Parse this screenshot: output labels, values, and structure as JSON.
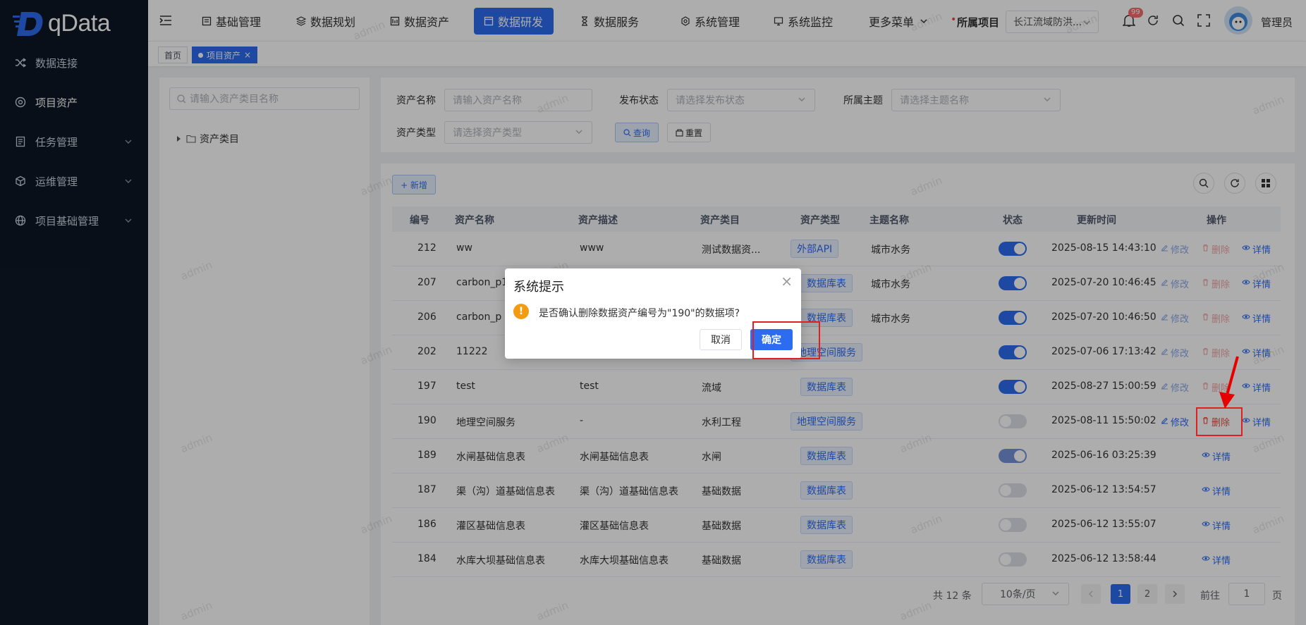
{
  "app": {
    "logo_text": "qData",
    "logo_letter": "D"
  },
  "sidebar": {
    "items": [
      {
        "label": "数据连接",
        "icon": "shuffle-icon",
        "has_children": false
      },
      {
        "label": "项目资产",
        "icon": "target-icon",
        "has_children": false
      },
      {
        "label": "任务管理",
        "icon": "document-list-icon",
        "has_children": true
      },
      {
        "label": "运维管理",
        "icon": "cube-icon",
        "has_children": true
      },
      {
        "label": "项目基础管理",
        "icon": "globe-icon",
        "has_children": true
      }
    ]
  },
  "topbar": {
    "menus": [
      {
        "label": "基础管理",
        "icon": "list-box-icon"
      },
      {
        "label": "数据规划",
        "icon": "layers-icon"
      },
      {
        "label": "数据资产",
        "icon": "database-doc-icon"
      },
      {
        "label": "数据研发",
        "icon": "window-icon",
        "active": true
      },
      {
        "label": "数据服务",
        "icon": "hourglass-icon"
      },
      {
        "label": "系统管理",
        "icon": "gear-icon"
      },
      {
        "label": "系统监控",
        "icon": "monitor-icon"
      },
      {
        "label": "更多菜单",
        "icon": "chevron-down-icon"
      }
    ],
    "project_label": "所属项目",
    "project_value": "长江流域防洪...",
    "notification_badge": "99",
    "user_name": "管理员"
  },
  "tags": {
    "home": "首页",
    "current": "项目资产"
  },
  "tree": {
    "search_placeholder": "请输入资产类目名称",
    "root_label": "资产类目"
  },
  "filters": {
    "name_label": "资产名称",
    "name_placeholder": "请输入资产名称",
    "status_label": "发布状态",
    "status_placeholder": "请选择发布状态",
    "theme_label": "所属主题",
    "theme_placeholder": "请选择主题名称",
    "type_label": "资产类型",
    "type_placeholder": "请选择资产类型",
    "query_button": "查询",
    "reset_button": "重置"
  },
  "toolbar": {
    "add_button": "+ 新增"
  },
  "table": {
    "columns": [
      "编号",
      "资产名称",
      "资产描述",
      "资产类目",
      "资产类型",
      "主题名称",
      "状态",
      "更新时间",
      "操作"
    ],
    "actions": {
      "edit": "修改",
      "delete": "删除",
      "detail": "详情"
    },
    "rows": [
      {
        "id": "212",
        "name": "ww",
        "desc": "www",
        "category": "测试数据资...",
        "type": "外部API",
        "theme": "城市水务",
        "status": "on",
        "updated": "2025-08-15 14:43:10",
        "actions": "full"
      },
      {
        "id": "207",
        "name": "carbon_p1",
        "desc": "",
        "category": "",
        "type": "数据库表",
        "theme": "城市水务",
        "status": "on",
        "updated": "2025-07-20 10:46:45",
        "actions": "full"
      },
      {
        "id": "206",
        "name": "carbon_p",
        "desc": "",
        "category": "",
        "type": "数据库表",
        "theme": "城市水务",
        "status": "on",
        "updated": "2025-07-20 10:46:50",
        "actions": "full"
      },
      {
        "id": "202",
        "name": "11222",
        "desc": "",
        "category": "",
        "type": "地理空间服务",
        "theme": "",
        "status": "on",
        "updated": "2025-07-06 17:13:42",
        "actions": "full"
      },
      {
        "id": "197",
        "name": "test",
        "desc": "test",
        "category": "流域",
        "type": "数据库表",
        "theme": "",
        "status": "on",
        "updated": "2025-08-27 15:00:59",
        "actions": "full"
      },
      {
        "id": "190",
        "name": "地理空间服务",
        "desc": "-",
        "category": "水利工程",
        "type": "地理空间服务",
        "theme": "",
        "status": "off",
        "updated": "2025-08-11 15:50:02",
        "actions": "full-strong"
      },
      {
        "id": "189",
        "name": "水闸基础信息表",
        "desc": "水闸基础信息表",
        "category": "水闸",
        "type": "数据库表",
        "theme": "",
        "status": "dim",
        "updated": "2025-06-16 03:25:39",
        "actions": "detail"
      },
      {
        "id": "187",
        "name": "渠（沟）道基础信息表",
        "desc": "渠（沟）道基础信息表",
        "category": "基础数据",
        "type": "数据库表",
        "theme": "",
        "status": "off",
        "updated": "2025-06-12 13:54:57",
        "actions": "detail"
      },
      {
        "id": "186",
        "name": "灌区基础信息表",
        "desc": "灌区基础信息表",
        "category": "基础数据",
        "type": "数据库表",
        "theme": "",
        "status": "off",
        "updated": "2025-06-12 13:55:07",
        "actions": "detail"
      },
      {
        "id": "184",
        "name": "水库大坝基础信息表",
        "desc": "水库大坝基础信息表",
        "category": "基础数据",
        "type": "数据库表",
        "theme": "",
        "status": "off",
        "updated": "2025-06-12 13:58:44",
        "actions": "detail"
      }
    ]
  },
  "pagination": {
    "total": "共 12 条",
    "page_size": "10条/页",
    "pages": [
      "1",
      "2"
    ],
    "current_page": "1",
    "goto_label": "前往",
    "goto_value": "1",
    "page_suffix": "页"
  },
  "dialog": {
    "title": "系统提示",
    "message": "是否确认删除数据资产编号为\"190\"的数据项?",
    "cancel": "取消",
    "confirm": "确定"
  },
  "watermark": "admin",
  "colors": {
    "primary": "#2d6cf0",
    "sidebar_bg": "#0e1726",
    "danger": "#e74c3c",
    "warning": "#f39c12",
    "highlight_box": "#e02020"
  }
}
